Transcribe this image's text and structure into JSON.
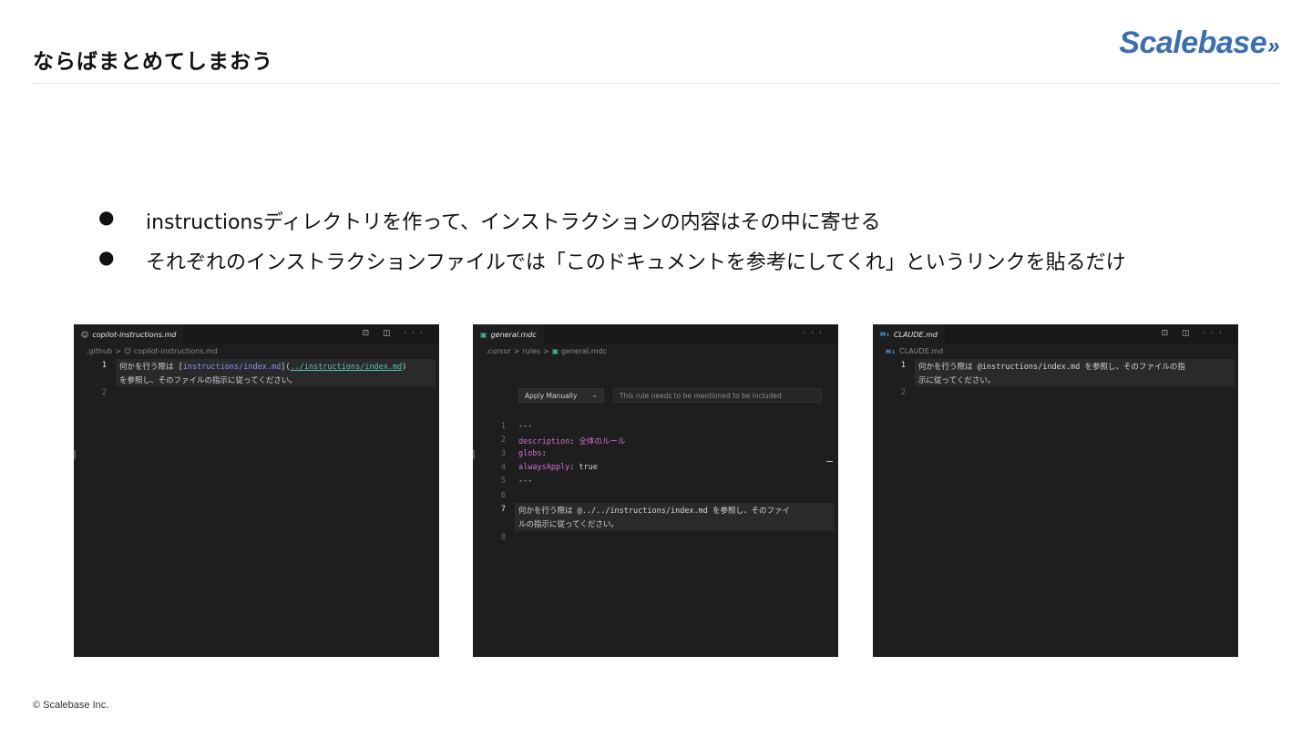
{
  "header": {
    "title": "ならばまとめてしまおう",
    "logo_text": "Scalebase",
    "logo_arrows": "»"
  },
  "bullets": [
    {
      "marker": "●",
      "text": "instructionsディレクトリを作って、インストラクションの内容はその中に寄せる"
    },
    {
      "marker": "●",
      "text": "それぞれのインストラクションファイルでは「このドキュメントを参考にしてくれ」というリンクを貼るだけ"
    }
  ],
  "panel1": {
    "tab_icon": "copilot-icon",
    "tab_label": "copilot-instructions.md",
    "actions": "⊡ ◫ ···",
    "breadcrumb": {
      "dir": ".github",
      "sep": ">",
      "icon": "copilot-icon",
      "file": "copilot-instructions.md"
    },
    "lines": [
      {
        "n": "1",
        "a": "何かを行う際は [",
        "b": "instructions/index.md",
        "c": "](",
        "d": "../instructions/index.md",
        "e": ")"
      },
      {
        "n": "",
        "a": "を参照し、そのファイルの指示に従ってください。"
      },
      {
        "n": "2",
        "a": ""
      }
    ]
  },
  "panel2": {
    "tab_label": "general.mdc",
    "actions": "···",
    "breadcrumb": {
      "dir1": ".cursor",
      "sep": ">",
      "dir2": "rules",
      "file": "general.mdc"
    },
    "apply_select": "Apply Manually",
    "apply_chevron": "⌄",
    "rule_note": "This rule needs to be mentioned to be included",
    "lines": [
      {
        "n": "1",
        "text": "---"
      },
      {
        "n": "2",
        "key": "description",
        "val": "全体のルール"
      },
      {
        "n": "3",
        "key": "globs",
        "val": ""
      },
      {
        "n": "4",
        "key": "alwaysApply",
        "val": "true"
      },
      {
        "n": "5",
        "text": "---"
      },
      {
        "n": "6",
        "text": ""
      },
      {
        "n": "7",
        "text": "何かを行う際は @../../instructions/index.md を参照し、そのファイ"
      },
      {
        "n": "",
        "text": "ルの指示に従ってください。"
      },
      {
        "n": "8",
        "text": ""
      }
    ]
  },
  "panel3": {
    "tab_icon": "M↓",
    "tab_label": "CLAUDE.md",
    "actions": "⊡ ◫ ···",
    "breadcrumb": {
      "icon": "M↓",
      "file": "CLAUDE.md"
    },
    "lines": [
      {
        "n": "1",
        "text": "何かを行う際は @instructions/index.md を参照し、そのファイルの指"
      },
      {
        "n": "",
        "text": "示に従ってください。"
      },
      {
        "n": "2",
        "text": ""
      }
    ]
  },
  "footer": {
    "copyright": "© Scalebase Inc."
  }
}
